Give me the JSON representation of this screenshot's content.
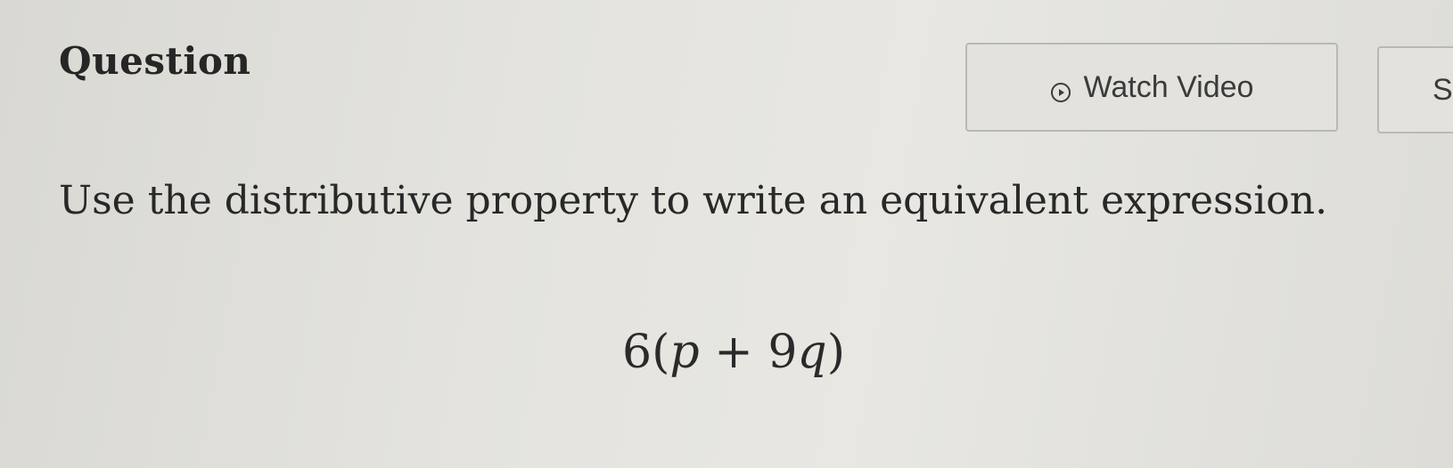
{
  "question": {
    "heading": "Question",
    "prompt": "Use the distributive property to write an equivalent expression.",
    "expression": {
      "coefficient": "6",
      "open_paren": "(",
      "var1": "p",
      "operator": " + ",
      "term_coef": "9",
      "var2": "q",
      "close_paren": ")"
    }
  },
  "toolbar": {
    "watch_video_label": "Watch Video",
    "next_button_partial_label": "S"
  },
  "icons": {
    "watch_video_icon": "play-circle-icon"
  }
}
